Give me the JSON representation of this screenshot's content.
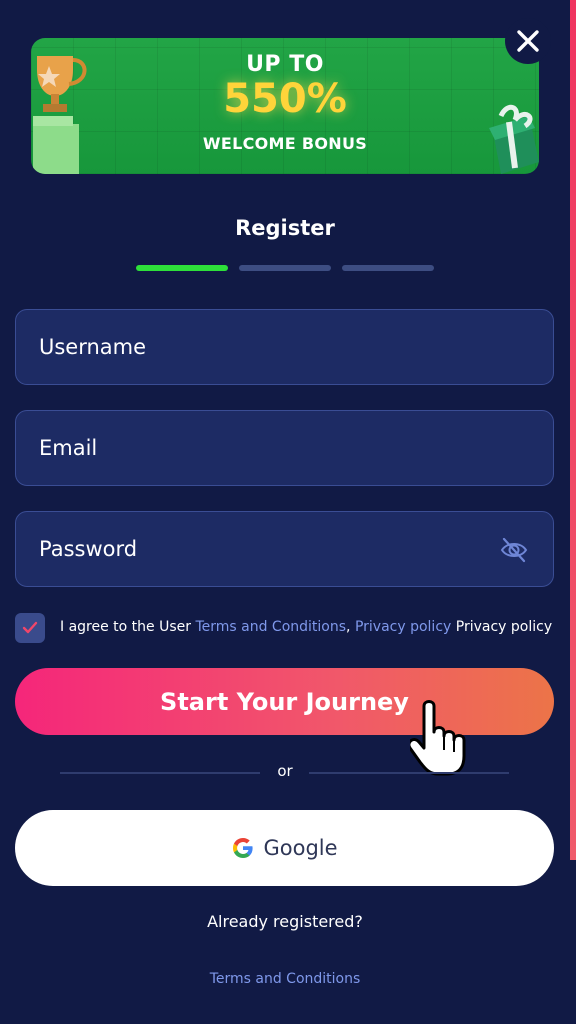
{
  "banner": {
    "line1": "UP TO",
    "line2": "550%",
    "line3": "WELCOME BONUS"
  },
  "form": {
    "title": "Register",
    "steps": {
      "count": 3,
      "active": 1
    },
    "username_placeholder": "Username",
    "email_placeholder": "Email",
    "password_placeholder": "Password",
    "agree_prefix": "I agree to the User",
    "terms_link": "Terms and Conditions",
    "comma": ",",
    "privacy_link": "Privacy policy",
    "privacy_text": "Privacy policy",
    "agree_checked": true,
    "submit_label": "Start Your Journey"
  },
  "separator": {
    "text": "or"
  },
  "social": {
    "google_label": "Google"
  },
  "footer": {
    "already_registered": "Already registered?",
    "terms_link": "Terms and Conditions"
  },
  "colors": {
    "background": "#111a45",
    "field_bg": "#1d2b64",
    "accent_green": "#2ee03a",
    "cta_gradient_start": "#f5267a",
    "cta_gradient_end": "#ec7448",
    "link": "#7f98ea"
  }
}
